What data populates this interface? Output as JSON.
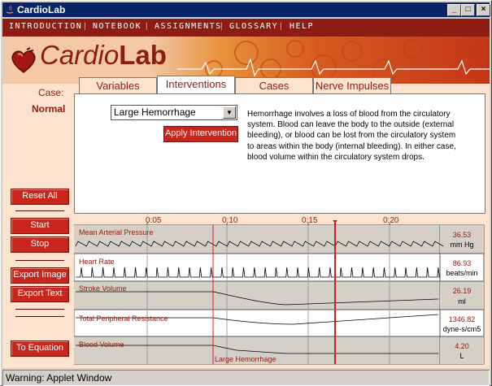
{
  "window": {
    "title": "CardioLab",
    "min_glyph": "_",
    "max_glyph": "□",
    "close_glyph": "×"
  },
  "menu": [
    "INTRODUCTION",
    "NOTEBOOK",
    "ASSIGNMENTS",
    "GLOSSARY",
    "HELP"
  ],
  "logo": {
    "part1": "Cardio",
    "part2": "Lab"
  },
  "case": {
    "label": "Case:",
    "value": "Normal"
  },
  "tabs": [
    "Variables",
    "Interventions",
    "Cases",
    "Nerve Impulses"
  ],
  "active_tab": "Interventions",
  "intervention": {
    "selected": "Large Hemorrhage",
    "apply_label": "Apply Intervention",
    "description": "Hemorrhage involves a loss of blood from the circulatory system.  Blood can leave the body to the outside (external bleeding), or blood can be lost from the circulatory system to areas within the body (internal bleeding). In either case, blood volume within the circulatory system drops."
  },
  "buttons": {
    "reset_all": "Reset All",
    "start": "Start",
    "stop": "Stop",
    "export_image": "Export Image",
    "export_text": "Export Text",
    "to_equation": "To Equation"
  },
  "chart_data": {
    "type": "line",
    "time_ticks": [
      "0:05",
      "0:10",
      "0:15",
      "0:20"
    ],
    "intervention_marker_label": "Large Hemorrhage",
    "series": [
      {
        "name": "Mean Arterial Pressure",
        "value": "36.53",
        "unit": "mm Hg"
      },
      {
        "name": "Heart Rate",
        "value": "86.93",
        "unit": "beats/min"
      },
      {
        "name": "Stroke Volume",
        "value": "26.19",
        "unit": "ml"
      },
      {
        "name": "Total Peripheral Resistance",
        "value": "1346.82",
        "unit": "dyne-s/cm5"
      },
      {
        "name": "Blood Volume",
        "value": "4.20",
        "unit": "L"
      }
    ]
  },
  "status": "Warning: Applet Window"
}
